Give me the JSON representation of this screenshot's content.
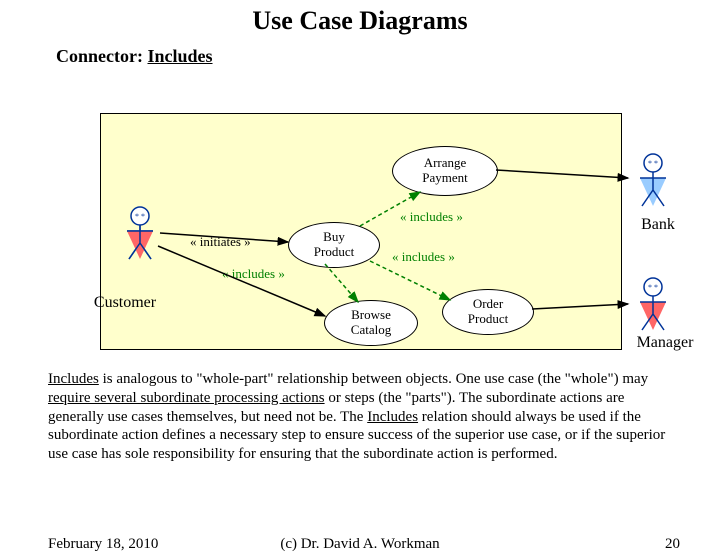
{
  "title": "Use Case Diagrams",
  "subtitle_prefix": "Connector: ",
  "subtitle_em": "Includes",
  "usecases": {
    "arrange": "Arrange\nPayment",
    "buy": "Buy\nProduct",
    "browse": "Browse\nCatalog",
    "order": "Order\nProduct"
  },
  "actors": {
    "customer": "Customer",
    "bank": "Bank",
    "manager": "Manager"
  },
  "labels": {
    "initiates": "« initiates »",
    "includes": "« includes »"
  },
  "paragraph": {
    "p1a": "Includes",
    "p1b": " is analogous to \"whole-part\" relationship between objects.  One use case (the \"whole\") may ",
    "p1c": "require several subordinate processing actions",
    "p1d": " or steps (the \"parts\"). The subordinate actions are generally use cases themselves, but need not be.  The ",
    "p1e": "Includes",
    "p1f": " relation should always be used if the subordinate action defines a necessary step to ensure success of the superior use case, or if the superior use case has sole responsibility for ensuring that the subordinate action is performed."
  },
  "footer": {
    "date": "February 18, 2010",
    "copy": "(c) Dr. David A. Workman",
    "page": "20"
  },
  "colors": {
    "box_bg": "#ffffcc",
    "includes": "#008000",
    "actor_line": "#003399",
    "actor_fill_red": "#ff6666",
    "actor_fill_blue": "#99ccff"
  }
}
